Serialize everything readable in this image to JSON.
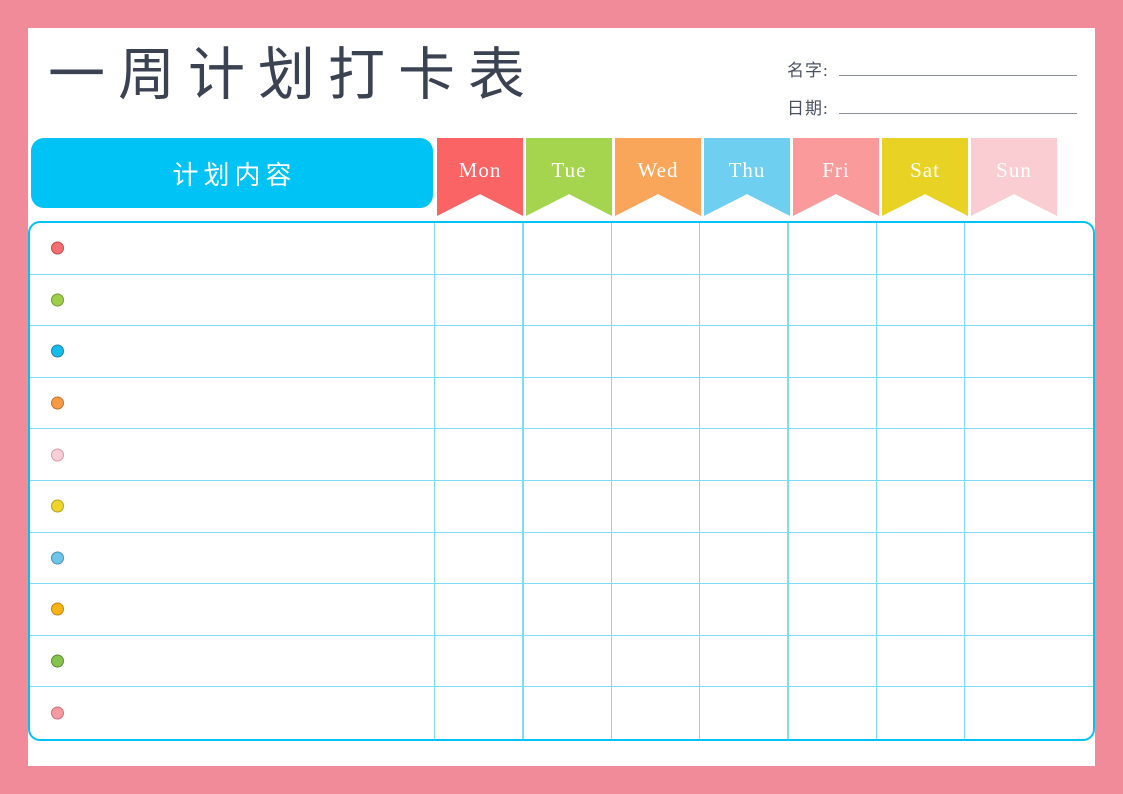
{
  "frame": {
    "border_color": "#f28b99",
    "background": "#ffffff"
  },
  "header": {
    "title": "一周计划打卡表",
    "title_color": "#3b4252",
    "fields": [
      {
        "label": "名字:",
        "value": ""
      },
      {
        "label": "日期:",
        "value": ""
      }
    ]
  },
  "table": {
    "border_color": "#00c3f5",
    "grid_line_color": "#7fdcf6",
    "plan_column": {
      "label": "计划内容",
      "background": "#00c3f5",
      "text_color": "#ffffff"
    },
    "day_columns": [
      {
        "label": "Mon",
        "color": "#fa6464"
      },
      {
        "label": "Tue",
        "color": "#a5d44e"
      },
      {
        "label": "Wed",
        "color": "#f9a55a"
      },
      {
        "label": "Thu",
        "color": "#6fcff0"
      },
      {
        "label": "Fri",
        "color": "#fb9a9a"
      },
      {
        "label": "Sat",
        "color": "#e8d324"
      },
      {
        "label": "Sun",
        "color": "#f9cdd1"
      }
    ],
    "rows": [
      {
        "bullet_color": "#f76e6e",
        "bullet_border": "#c24a4a",
        "text": ""
      },
      {
        "bullet_color": "#9dcf4b",
        "bullet_border": "#6f9c2f",
        "text": ""
      },
      {
        "bullet_color": "#11bdec",
        "bullet_border": "#2c7fa0",
        "text": ""
      },
      {
        "bullet_color": "#f79a45",
        "bullet_border": "#c07130",
        "text": ""
      },
      {
        "bullet_color": "#f8cfd6",
        "bullet_border": "#d79aa6",
        "text": ""
      },
      {
        "bullet_color": "#efd529",
        "bullet_border": "#b3a01c",
        "text": ""
      },
      {
        "bullet_color": "#6ec5ea",
        "bullet_border": "#4a8eb0",
        "text": ""
      },
      {
        "bullet_color": "#fbb314",
        "bullet_border": "#c0870e",
        "text": ""
      },
      {
        "bullet_color": "#86c34b",
        "bullet_border": "#5d8c2f",
        "text": ""
      },
      {
        "bullet_color": "#f79aa2",
        "bullet_border": "#cc6f78",
        "text": ""
      }
    ]
  }
}
